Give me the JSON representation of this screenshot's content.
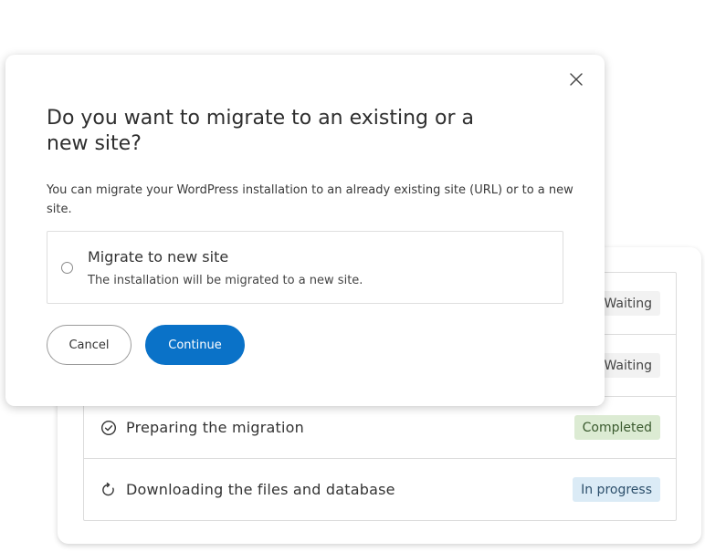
{
  "migration_status": {
    "steps": [
      {
        "label": "",
        "status": "Waiting",
        "icon": "none"
      },
      {
        "label": "",
        "status": "Waiting",
        "icon": "none"
      },
      {
        "label": "Preparing the migration",
        "status": "Completed",
        "icon": "check-circle-icon"
      },
      {
        "label": "Downloading the files and database",
        "status": "In progress",
        "icon": "refresh-icon"
      }
    ]
  },
  "modal": {
    "title": "Do you want to migrate to an existing or a new site?",
    "description": "You can migrate your WordPress installation to an already existing site (URL) or to a new site.",
    "option": {
      "title": "Migrate to new site",
      "subtitle": "The installation will be migrated to a new site.",
      "selected": false
    },
    "cancel_label": "Cancel",
    "continue_label": "Continue"
  },
  "colors": {
    "primary": "#0a72c8",
    "completed_badge": "#dcebd3",
    "in_progress_badge": "#dbebf6",
    "waiting_badge": "#f2f2f2"
  }
}
